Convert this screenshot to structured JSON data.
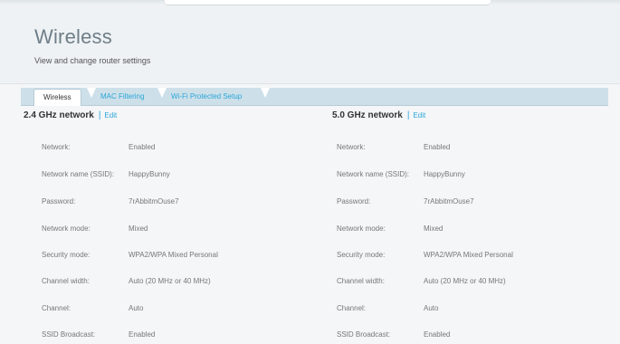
{
  "header": {
    "title": "Wireless",
    "subtitle": "View and change router settings",
    "close_glyph": "⊠"
  },
  "tabs": [
    {
      "label": "Wireless",
      "active": true
    },
    {
      "label": "MAC Filtering",
      "active": false
    },
    {
      "label": "Wi-Fi Protected Setup",
      "active": false
    }
  ],
  "sections": [
    {
      "title": "2.4 GHz network",
      "separator": "|",
      "edit_label": "Edit",
      "rows": [
        {
          "label": "Network:",
          "value": "Enabled"
        },
        {
          "label": "Network name (SSID):",
          "value": "HappyBunny"
        },
        {
          "label": "Password:",
          "value": "7rAbbitmOuse7"
        },
        {
          "label": "Network mode:",
          "value": "Mixed"
        },
        {
          "label": "Security mode:",
          "value": "WPA2/WPA Mixed Personal"
        },
        {
          "label": "Channel width:",
          "value": "Auto (20 MHz or 40 MHz)"
        },
        {
          "label": "Channel:",
          "value": "Auto"
        },
        {
          "label": "SSID Broadcast:",
          "value": "Enabled"
        }
      ]
    },
    {
      "title": "5.0 GHz network",
      "separator": "|",
      "edit_label": "Edit",
      "rows": [
        {
          "label": "Network:",
          "value": "Enabled"
        },
        {
          "label": "Network name (SSID):",
          "value": "HappyBunny"
        },
        {
          "label": "Password:",
          "value": "7rAbbitmOuse7"
        },
        {
          "label": "Network mode:",
          "value": "Mixed"
        },
        {
          "label": "Security mode:",
          "value": "WPA2/WPA Mixed Personal"
        },
        {
          "label": "Channel width:",
          "value": "Auto (20 MHz or 40 MHz)"
        },
        {
          "label": "Channel:",
          "value": "Auto"
        },
        {
          "label": "SSID Broadcast:",
          "value": "Enabled"
        }
      ]
    }
  ],
  "colors": {
    "accent": "#2aa6d8",
    "tab_bar": "#cde0e9",
    "title": "#6e7e88"
  }
}
